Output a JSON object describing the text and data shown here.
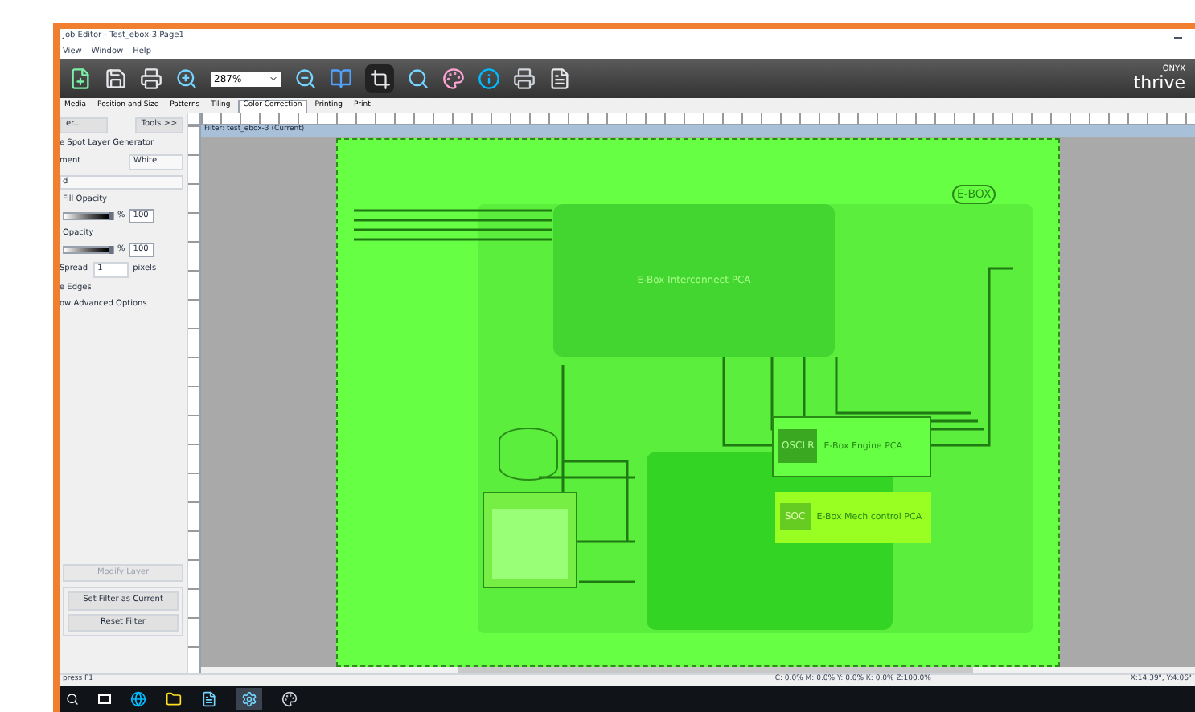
{
  "window": {
    "title": "Job Editor - Test_ebox-3.Page1"
  },
  "menu": [
    "View",
    "Window",
    "Help"
  ],
  "toolbar": {
    "zoom": "287%",
    "logo_top": "ONYX",
    "logo_bottom": "thrive"
  },
  "tabs": [
    {
      "label": "Media",
      "selected": false
    },
    {
      "label": "Position and Size",
      "selected": false
    },
    {
      "label": "Patterns",
      "selected": false
    },
    {
      "label": "Tiling",
      "selected": false
    },
    {
      "label": "Color Correction",
      "selected": true
    },
    {
      "label": "Printing",
      "selected": false
    },
    {
      "label": "Print",
      "selected": false
    }
  ],
  "left_panel": {
    "filter_button": "er...",
    "tools_button": "Tools >>",
    "section_title": "e Spot Layer Generator",
    "element_label": "ment",
    "element_value": "White",
    "second_dropdown": "d",
    "fill_opacity": {
      "label": "Fill Opacity",
      "value": "100",
      "unit": "%",
      "level": 1
    },
    "opacity": {
      "label": "Opacity",
      "value": "100",
      "unit": "%",
      "level": 1
    },
    "spread": {
      "label": "Spread",
      "value": "1",
      "unit": "pixels"
    },
    "edges": "e Edges",
    "advanced": "ow Advanced Options",
    "modify": {
      "label": "Modify Layer",
      "disabled": true
    },
    "set_filter": "Set Filter as Current",
    "reset_filter": "Reset Filter"
  },
  "document": {
    "tab": "Filter: test_ebox-3 (Current)",
    "diagram": {
      "badge": "E-BOX",
      "interconnect": "E-Box Interconnect PCA",
      "engine": "E-Box Engine PCA",
      "engine_chip": "OSCLR",
      "mech": "E-Box Mech control PCA",
      "mech_chip": "SOC"
    }
  },
  "status_bar": {
    "hint": "press F1",
    "ink": "C: 0.0% M: 0.0% Y: 0.0% K: 0.0% Z:100.0%",
    "position": "X:14.39\", Y:4.06\""
  }
}
